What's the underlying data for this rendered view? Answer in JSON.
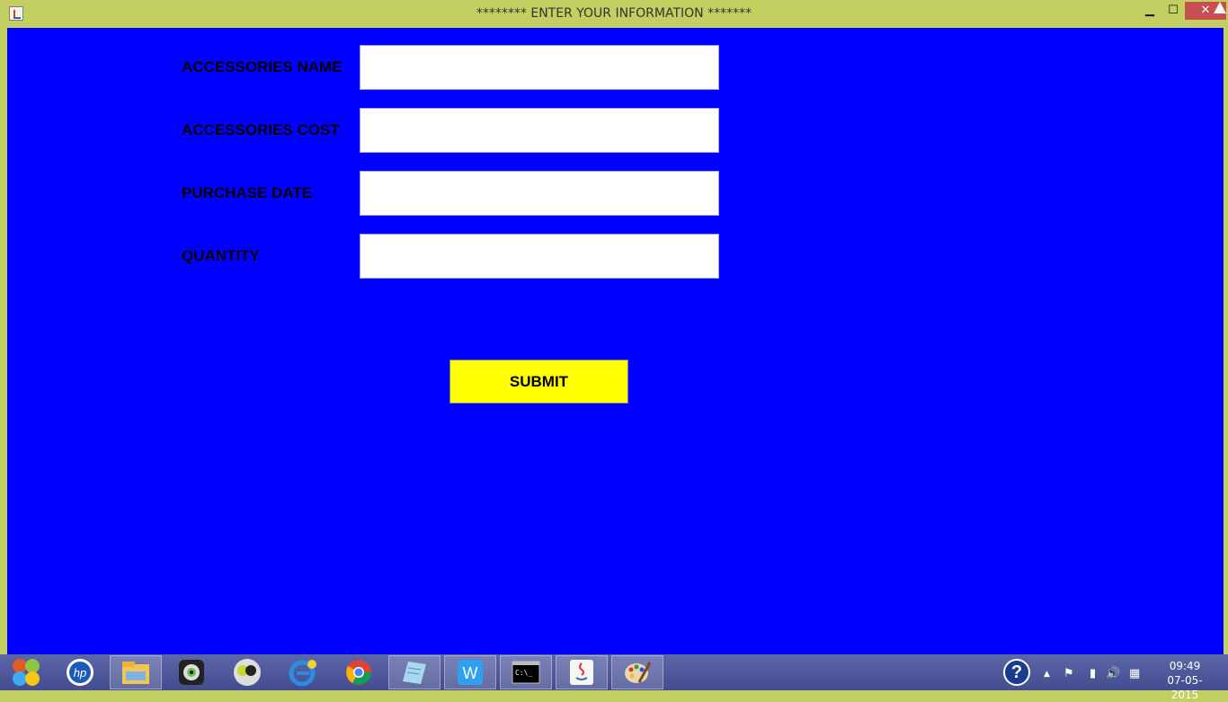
{
  "window": {
    "title": "********  ENTER YOUR INFORMATION  *******",
    "minimize_glyph": "▁",
    "maximize_glyph": "☐",
    "close_glyph": "✕"
  },
  "form": {
    "fields": [
      {
        "label": "ACCESSORIES NAME",
        "value": ""
      },
      {
        "label": "ACCESSORIES COST",
        "value": ""
      },
      {
        "label": "PURCHASE DATE",
        "value": ""
      },
      {
        "label": "QUANTITY",
        "value": ""
      }
    ],
    "submit_label": "SUBMIT"
  },
  "colors": {
    "client_bg": "#0000ff",
    "frame": "#c3cf61",
    "submit_bg": "#ffff00",
    "close_bg": "#c74f50"
  },
  "taskbar": {
    "apps": [
      "windows-start-icon",
      "hp-icon",
      "file-explorer-icon",
      "webcam-icon",
      "media-player-icon",
      "internet-explorer-icon",
      "chrome-icon",
      "notepad-icon",
      "wps-writer-icon",
      "command-prompt-icon",
      "java-icon",
      "paint-icon"
    ],
    "tray": {
      "help_glyph": "?",
      "up_arrow": "▲",
      "flag_glyph": "⚑",
      "battery_glyph": "▮",
      "volume_glyph": "🔊",
      "network_glyph": "▦"
    },
    "clock_time": "09:49",
    "clock_date": "07-05-2015"
  }
}
